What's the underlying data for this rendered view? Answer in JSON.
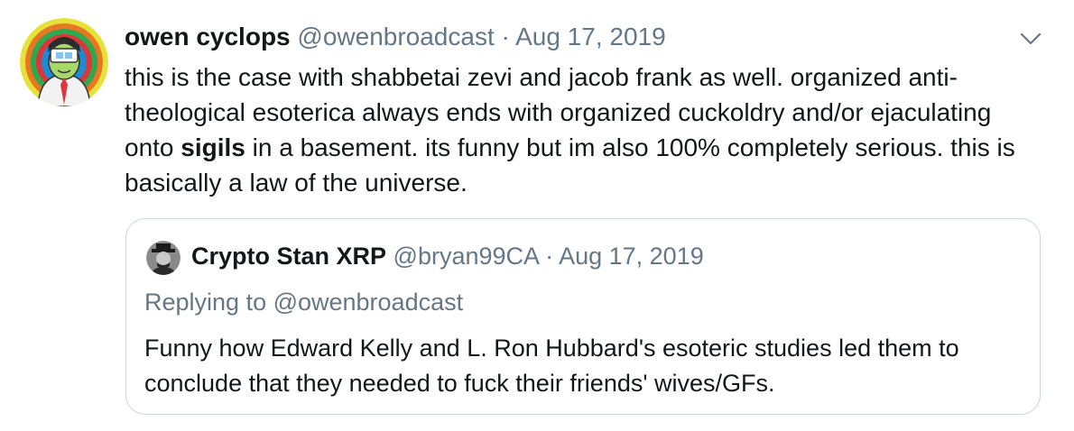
{
  "tweet": {
    "display_name": "owen cyclops",
    "handle": "@owenbroadcast",
    "separator": "·",
    "date": "Aug 17, 2019",
    "body_before": "this is the case with shabbetai zevi and jacob frank as well. organized anti-theological esoterica always ends with organized cuckoldry and/or ejaculating onto ",
    "body_bold": "sigils",
    "body_after": " in a basement. its funny but im also 100% completely serious. this is basically a law of the universe."
  },
  "quoted_tweet": {
    "display_name": "Crypto Stan XRP",
    "handle": "@bryan99CA",
    "separator": "·",
    "date": "Aug 17, 2019",
    "replying_to": "Replying to @owenbroadcast",
    "body": "Funny how Edward Kelly and L. Ron Hubbard's esoteric studies led them to conclude that they needed to fuck their friends' wives/GFs."
  },
  "icons": {
    "menu": "chevron-down-icon"
  },
  "colors": {
    "text": "#14171a",
    "muted": "#657786",
    "border": "#ccd6dd"
  }
}
